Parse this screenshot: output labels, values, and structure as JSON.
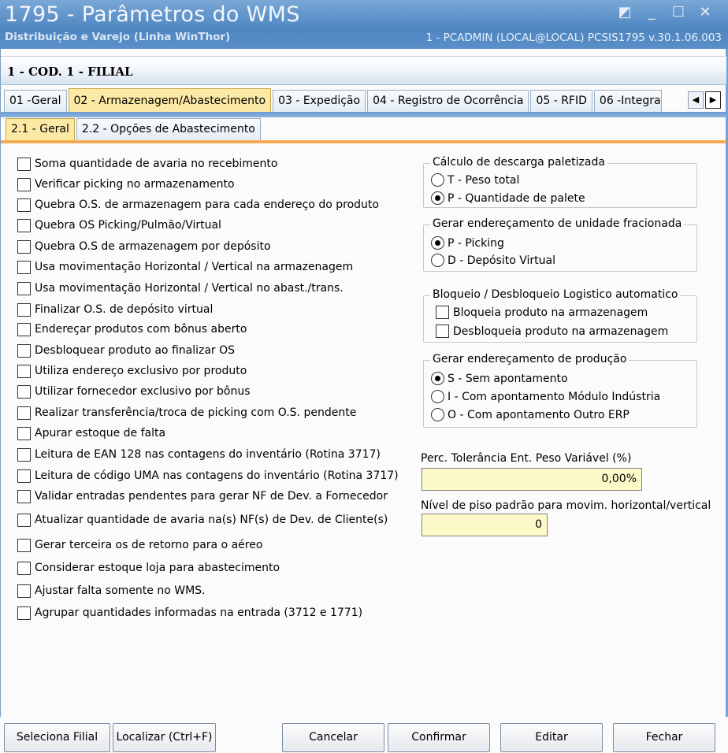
{
  "window": {
    "title": "1795 - Parâmetros do WMS",
    "subtitle": "Distribuição e Varejo (Linha WinThor)",
    "info": "1 - PCADMIN (LOCAL@LOCAL)   PCSIS1795  v.30.1.06.003"
  },
  "heading": "1 - COD. 1 - FILIAL",
  "tabs": [
    "01 -Geral",
    "02 - Armazenagem/Abastecimento",
    "03 - Expedição",
    "04 - Registro de Ocorrência",
    "05 - RFID",
    "06 -Integra"
  ],
  "subtabs": [
    "2.1 - Geral",
    "2.2 - Opções de Abastecimento"
  ],
  "checkboxes": [
    "Soma quantidade de avaria no recebimento",
    "Verificar picking no armazenamento",
    "Quebra O.S. de armazenagem para cada endereço do produto",
    "Quebra OS Picking/Pulmão/Virtual",
    "Quebra O.S de armazenagem por depósito",
    "Usa movimentação Horizontal / Vertical na armazenagem",
    "Usa movimentação Horizontal / Vertical no abast./trans.",
    "Finalizar O.S. de depósito virtual",
    "Endereçar produtos com bônus aberto",
    "Desbloquear produto ao finalizar OS",
    "Utiliza endereço exclusivo por produto",
    "Utilizar fornecedor exclusivo por bônus",
    "Realizar transferência/troca de picking com O.S. pendente",
    "Apurar estoque de falta",
    "Leitura de EAN 128 nas contagens do inventário (Rotina 3717)",
    "Leitura de código UMA nas contagens do inventário (Rotina 3717)",
    "Validar entradas pendentes para gerar NF de Dev. a Fornecedor",
    "Atualizar quantidade de avaria na(s) NF(s) de Dev. de Cliente(s)",
    "Gerar terceira os de retorno para o aéreo",
    "Considerar estoque loja para abastecimento",
    "Ajustar falta somente no WMS.",
    "Agrupar quantidades informadas na entrada (3712 e 1771)"
  ],
  "groups": {
    "descarga": {
      "title": "Cálculo de descarga paletizada",
      "options": [
        "T - Peso total",
        "P - Quantidade de palete"
      ],
      "selected": 1
    },
    "fracionada": {
      "title": "Gerar endereçamento de unidade fracionada",
      "options": [
        "P - Picking",
        "D - Depósito Virtual"
      ],
      "selected": 0
    },
    "bloqueio": {
      "title": "Bloqueio / Desbloqueio Logistico automatico",
      "options": [
        "Bloqueia produto na armazenagem",
        "Desbloqueia produto na armazenagem"
      ]
    },
    "producao": {
      "title": "Gerar endereçamento de produção",
      "options": [
        "S - Sem apontamento",
        "I - Com apontamento Módulo Indústria",
        "O - Com apontamento Outro ERP"
      ],
      "selected": 0
    }
  },
  "fields": {
    "tolerancia": {
      "label": "Perc. Tolerância Ent. Peso Variável (%)",
      "value": "0,00%"
    },
    "piso": {
      "label": "Nível de piso padrão para movim. horizontal/vertical",
      "value": "0"
    }
  },
  "buttons": {
    "seleciona_filial": "Seleciona Filial",
    "localizar": "Localizar (Ctrl+F)",
    "cancelar": "Cancelar",
    "confirmar": "Confirmar",
    "editar": "Editar",
    "fechar": "Fechar"
  }
}
